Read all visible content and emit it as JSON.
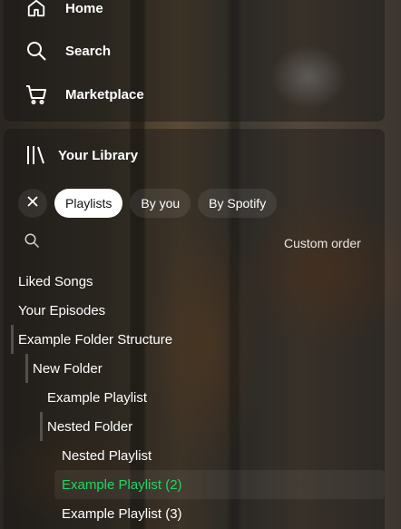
{
  "nav": {
    "home": "Home",
    "search": "Search",
    "marketplace": "Marketplace"
  },
  "library": {
    "title": "Your Library",
    "filters": [
      "Playlists",
      "By you",
      "By Spotify"
    ],
    "active_filter": "Playlists",
    "sort_label": "Custom order"
  },
  "tree": [
    {
      "label": "Liked Songs",
      "depth": 0
    },
    {
      "label": "Your Episodes",
      "depth": 0
    },
    {
      "label": "Example Folder Structure",
      "depth": 0,
      "folder": true
    },
    {
      "label": "New Folder",
      "depth": 1,
      "folder": true
    },
    {
      "label": "Example Playlist",
      "depth": 2
    },
    {
      "label": "Nested Folder",
      "depth": 2,
      "folder": true
    },
    {
      "label": "Nested Playlist",
      "depth": 3
    },
    {
      "label": "Example Playlist (2)",
      "depth": 3,
      "active": true
    },
    {
      "label": "Example Playlist (3)",
      "depth": 3
    }
  ],
  "colors": {
    "accent_green": "#1ed760",
    "chip_active_bg": "#ffffff"
  },
  "icons": {
    "home": "home-icon",
    "search": "search-icon",
    "marketplace": "cart-icon",
    "library": "library-icon",
    "close": "close-icon"
  }
}
